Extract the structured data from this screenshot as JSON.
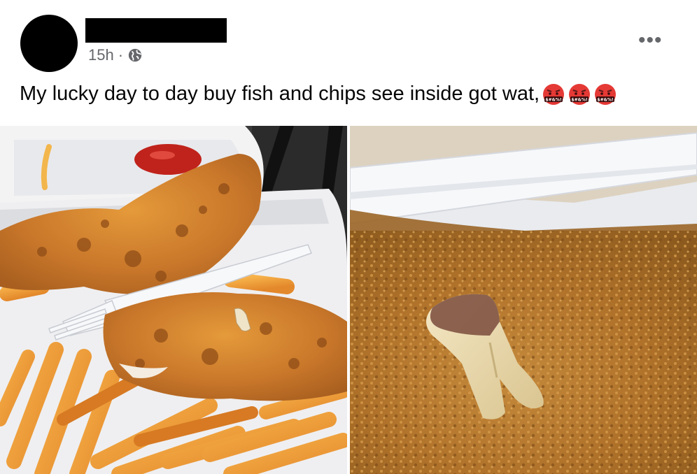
{
  "post": {
    "timestamp": "15h",
    "separator": "·",
    "privacy_icon": "globe-icon",
    "more_icon": "more-options-icon",
    "more_label": "•••",
    "caption": "My lucky day to day buy fish and chips see inside got wat,",
    "emojis": [
      "face-with-symbols-on-mouth",
      "face-with-symbols-on-mouth",
      "face-with-symbols-on-mouth"
    ],
    "emoji_text": "$#&%!",
    "photos": [
      {
        "subject": "fried-fish-and-chips"
      },
      {
        "subject": "close-up-tooth-in-batter"
      }
    ]
  },
  "colors": {
    "text_primary": "#050505",
    "text_secondary": "#65676b",
    "redaction": "#000000",
    "emoji_red": "#e53935"
  }
}
